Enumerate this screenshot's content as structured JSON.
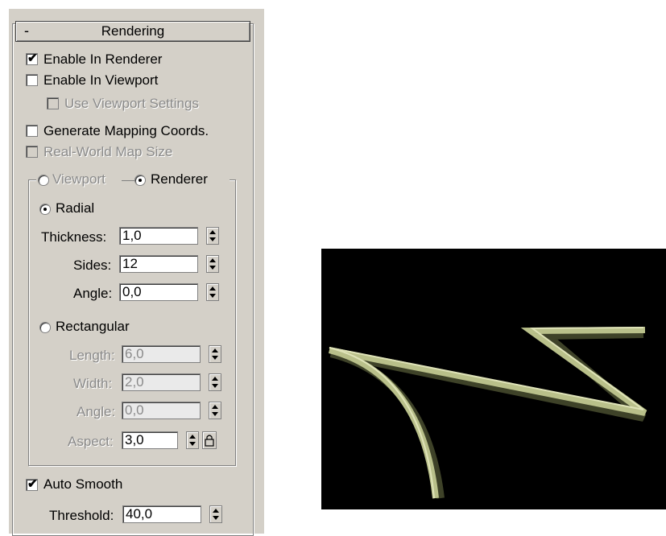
{
  "rollout": {
    "collapse_symbol": "-",
    "title": "Rendering"
  },
  "checkboxes": {
    "enable_in_renderer": {
      "label": "Enable In Renderer",
      "checked": true
    },
    "enable_in_viewport": {
      "label": "Enable In Viewport",
      "checked": false
    },
    "use_viewport_settings": {
      "label": "Use Viewport Settings",
      "checked": false,
      "disabled": true
    },
    "generate_mapping_coords": {
      "label": "Generate Mapping Coords.",
      "checked": false
    },
    "real_world_map_size": {
      "label": "Real-World Map Size",
      "checked": false,
      "disabled": true
    },
    "auto_smooth": {
      "label": "Auto Smooth",
      "checked": true
    }
  },
  "mode_radios": {
    "viewport": {
      "label": "Viewport",
      "selected": false
    },
    "renderer": {
      "label": "Renderer",
      "selected": true
    }
  },
  "radial": {
    "label": "Radial",
    "selected": true,
    "thickness": {
      "label": "Thickness:",
      "value": "1,0"
    },
    "sides": {
      "label": "Sides:",
      "value": "12"
    },
    "angle": {
      "label": "Angle:",
      "value": "0,0"
    }
  },
  "rectangular": {
    "label": "Rectangular",
    "selected": false,
    "length": {
      "label": "Length:",
      "value": "6,0"
    },
    "width": {
      "label": "Width:",
      "value": "2,0"
    },
    "angle": {
      "label": "Angle:",
      "value": "0,0"
    },
    "aspect": {
      "label": "Aspect:",
      "value": "3,0"
    }
  },
  "threshold": {
    "label": "Threshold:",
    "value": "40,0"
  },
  "colors": {
    "panel": "#d4d0c8",
    "viewport_bg": "#000000",
    "spline": "#b9c08a"
  },
  "icons": {
    "check": "✔",
    "lock": "lock-icon"
  }
}
